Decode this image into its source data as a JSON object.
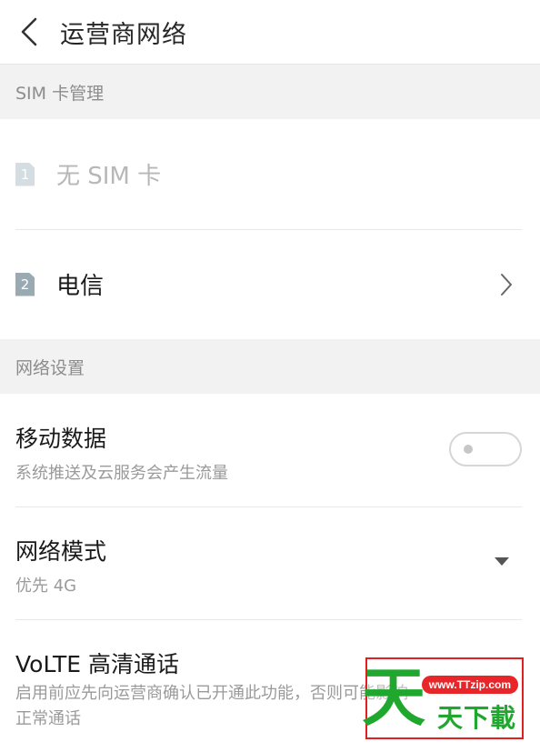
{
  "header": {
    "title": "运营商网络",
    "back_icon": "chevron-left-icon"
  },
  "sim_section": {
    "title": "SIM 卡管理",
    "items": [
      {
        "slot": "1",
        "name": "无 SIM 卡",
        "enabled": false
      },
      {
        "slot": "2",
        "name": "电信",
        "enabled": true,
        "chevron_icon": "chevron-right-icon"
      }
    ]
  },
  "network_section": {
    "title": "网络设置",
    "mobile_data": {
      "title": "移动数据",
      "subtitle": "系统推送及云服务会产生流量",
      "toggle_on": false
    },
    "network_mode": {
      "title": "网络模式",
      "value": "优先 4G",
      "icon": "dropdown-arrow-icon"
    },
    "volte": {
      "title": "VoLTE 高清通话",
      "subtitle": "启用前应先向运营商确认已开通此功能，否则可能影响正常通话"
    }
  },
  "watermark": {
    "url": "www.TTzip.com",
    "big_char": "天",
    "small_text": "天下載"
  },
  "colors": {
    "section_bg": "#f2f2f2",
    "divider": "#e8e8e8",
    "secondary_text": "#9a9a9a",
    "watermark_green": "#1fa82d",
    "watermark_red": "#e02020"
  }
}
